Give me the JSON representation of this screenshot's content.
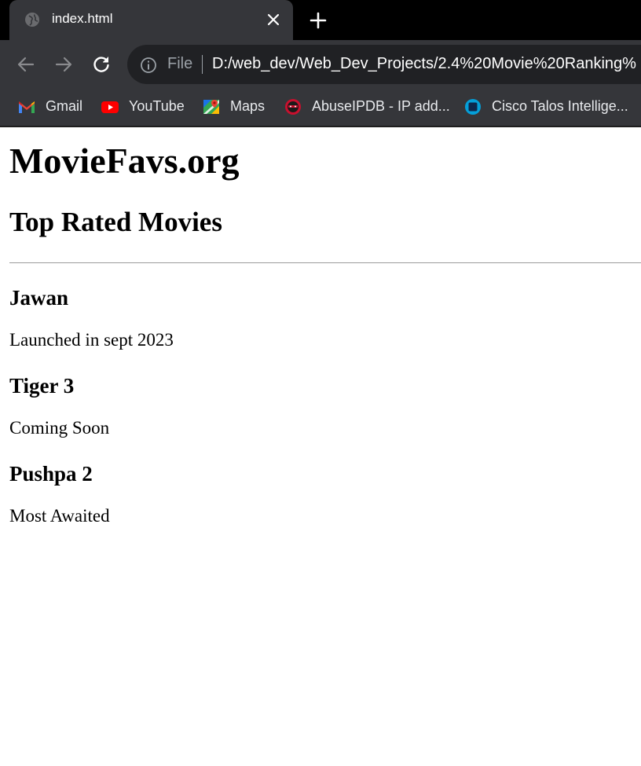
{
  "browser": {
    "tab": {
      "title": "index.html"
    },
    "address_bar": {
      "scheme_label": "File",
      "url": "D:/web_dev/Web_Dev_Projects/2.4%20Movie%20Ranking%"
    },
    "bookmarks": [
      {
        "label": "Gmail",
        "icon": "gmail-icon"
      },
      {
        "label": "YouTube",
        "icon": "youtube-icon"
      },
      {
        "label": "Maps",
        "icon": "maps-icon"
      },
      {
        "label": "AbuseIPDB - IP add...",
        "icon": "abuseipdb-icon"
      },
      {
        "label": "Cisco Talos Intellige...",
        "icon": "cisco-talos-icon"
      }
    ]
  },
  "page": {
    "site_title": "MovieFavs.org",
    "section_title": "Top Rated Movies",
    "movies": [
      {
        "title": "Jawan",
        "description": "Launched in sept 2023"
      },
      {
        "title": "Tiger 3",
        "description": "Coming Soon"
      },
      {
        "title": "Pushpa 2",
        "description": "Most Awaited"
      }
    ]
  },
  "colors": {
    "tabstrip_bg": "#000000",
    "toolbar_bg": "#35363a",
    "omnibox_bg": "#202124",
    "page_bg": "#ffffff"
  }
}
